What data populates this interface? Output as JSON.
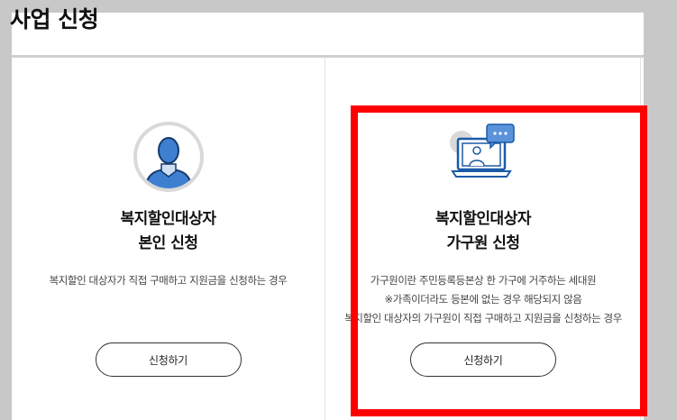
{
  "page": {
    "title": "사업 신청"
  },
  "cards": [
    {
      "icon": "user-avatar-icon",
      "title_line1": "복지할인대상자",
      "title_line2": "본인 신청",
      "desc": [
        "복지할인 대상자가 직접 구매하고 지원금을 신청하는 경우"
      ],
      "button_label": "신청하기"
    },
    {
      "icon": "video-call-laptop-icon",
      "title_line1": "복지할인대상자",
      "title_line2": "가구원 신청",
      "desc": [
        "가구원이란 주민등록등본상 한 가구에 거주하는 세대원",
        "※가족이더라도 등본에 없는 경우 해당되지 않음",
        "복지할인 대상자의 가구원이 직접 구매하고 지원금을 신청하는 경우"
      ],
      "button_label": "신청하기"
    }
  ],
  "colors": {
    "highlight": "#ff0000",
    "icon_blue": "#1a5ba8",
    "icon_gray": "#d9d9d9"
  }
}
